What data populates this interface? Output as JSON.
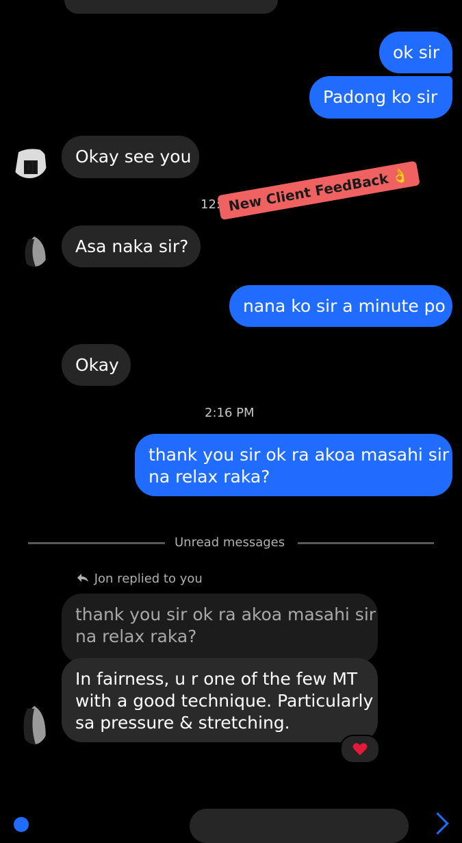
{
  "colors": {
    "outgoing_bubble": "#1f6cff",
    "incoming_bubble": "#262626",
    "background": "#000000",
    "sticker_bg": "#ff6b6b",
    "reaction": "#e5193a"
  },
  "messages": {
    "m1": "ok sir",
    "m2": "Padong ko sir",
    "m3": "Okay see you",
    "m4": "Asa naka sir?",
    "m5": "nana ko sir a minute po",
    "m6": "Okay",
    "m7_line1": "thank you sir ok ra akoa masahi sir",
    "m7_line2": "na relax raka?",
    "quoted_line1": "thank you sir ok ra akoa masahi sir",
    "quoted_line2": "na relax raka?",
    "m8_line1": "In fairness, u r one of the few MT",
    "m8_line2": "with a good technique. Particularly",
    "m8_line3": "sa pressure & stretching."
  },
  "timestamps": {
    "t1": "12:37 PM",
    "t2": "2:16 PM"
  },
  "divider": {
    "label": "Unread messages"
  },
  "reply": {
    "label": "Jon replied to you",
    "icon": "reply-arrow-icon"
  },
  "sticker": {
    "text": "New Client FeedBack",
    "emoji": "👌"
  },
  "reaction": {
    "emoji": "❤️"
  }
}
